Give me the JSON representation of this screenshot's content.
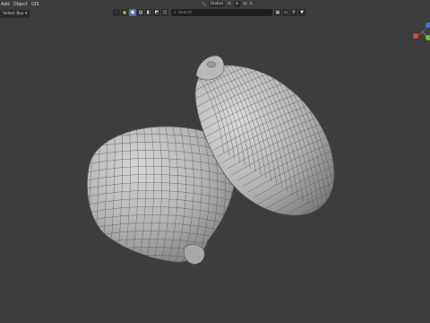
{
  "menu": {
    "items": [
      "Add",
      "Object",
      "GIS"
    ]
  },
  "select_mode": {
    "label": "Select Box ▾"
  },
  "top_controls": {
    "transform_label": "Global",
    "snap_icon": "snap-icon",
    "pivot_icon": "pivot-icon"
  },
  "search": {
    "placeholder": "Search"
  },
  "colors": {
    "viewport_bg": "#3d3d3d",
    "active_button": "#4772b3",
    "mesh_fill": "#b5b5b5",
    "wire": "#4a4a4a",
    "gizmo_x": "#e0473c",
    "gizmo_y": "#7cbd33",
    "gizmo_z": "#3e76d6"
  }
}
